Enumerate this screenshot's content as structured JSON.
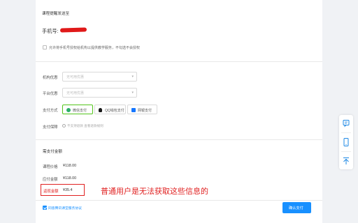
{
  "auth": {
    "title": "课程提醒发送至",
    "phone_label": "手机号:",
    "consent_text": "允许将手机号授权给机构以提供教学服务，不勾选不会授权"
  },
  "discounts": {
    "org_label": "机构优惠",
    "org_placeholder": "无可用优惠",
    "platform_label": "平台优惠",
    "platform_placeholder": "无可用优惠"
  },
  "payment": {
    "method_label": "支付方式",
    "methods": [
      {
        "label": "微信支付",
        "icon": "wechat-icon",
        "color": "#2aae67",
        "selected": true
      },
      {
        "label": "QQ钱包支付",
        "icon": "qq-icon",
        "color": "#1a1a1a",
        "selected": false
      },
      {
        "label": "网银支付",
        "icon": "bank-card-icon",
        "color": "#1677ff",
        "selected": false
      }
    ],
    "guarantee_label": "支付保障",
    "guarantee_text": "不支持退款  查看退款规则"
  },
  "summary": {
    "title": "需支付金额",
    "course_price_label": "课程价格",
    "course_price_value": "¥118.00",
    "total_label": "应付金额",
    "total_value": "¥118.00",
    "rebate_label": "返现金额",
    "rebate_value": "¥35.4"
  },
  "annotation": {
    "text": "普通用户是无法获取这些信息的",
    "color": "#e02020"
  },
  "footer": {
    "agree_text": "同意腾讯课堂服务协议",
    "confirm_label": "确认支付"
  },
  "sidebar": {
    "icons": [
      "feedback-icon",
      "mobile-icon",
      "back-to-top-icon"
    ]
  },
  "colors": {
    "accent": "#1890ff",
    "annotation_red": "#e02020"
  }
}
